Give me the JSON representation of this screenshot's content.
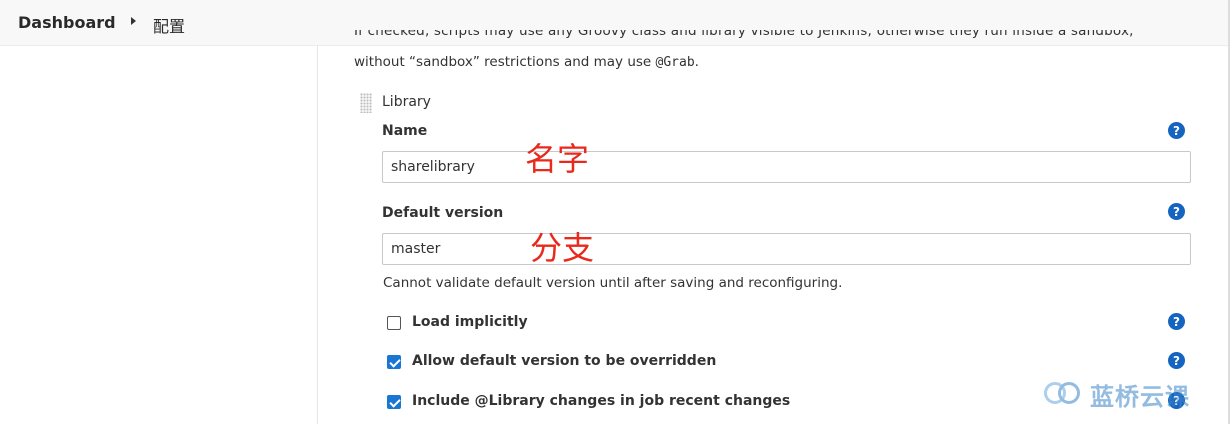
{
  "breadcrumb": {
    "home": "Dashboard",
    "current": "配置"
  },
  "description": {
    "line1_cut": "If checked, scripts may use any Groovy class and library visible to Jenkins; otherwise they run inside a sandbox,",
    "line2_prefix": "without “sandbox” restrictions and may use ",
    "line2_code": "@Grab",
    "line2_suffix": "."
  },
  "library": {
    "section_title": "Library",
    "name_label": "Name",
    "name_value": "sharelibrary",
    "name_annotation": "名字",
    "version_label": "Default version",
    "version_value": "master",
    "version_annotation": "分支",
    "validation_message": "Cannot validate default version until after saving and reconfiguring.",
    "options": [
      {
        "label": "Load implicitly",
        "checked": false
      },
      {
        "label": "Allow default version to be overridden",
        "checked": true
      },
      {
        "label": "Include @Library changes in job recent changes",
        "checked": true
      }
    ],
    "help_glyph": "?"
  },
  "watermark": {
    "text": "蓝桥云课",
    "icon": "lanqiao-logo-icon"
  },
  "colors": {
    "help_blue": "#1565c0",
    "checkbox_blue": "#1976d2",
    "annotation_red": "#e8291c"
  }
}
